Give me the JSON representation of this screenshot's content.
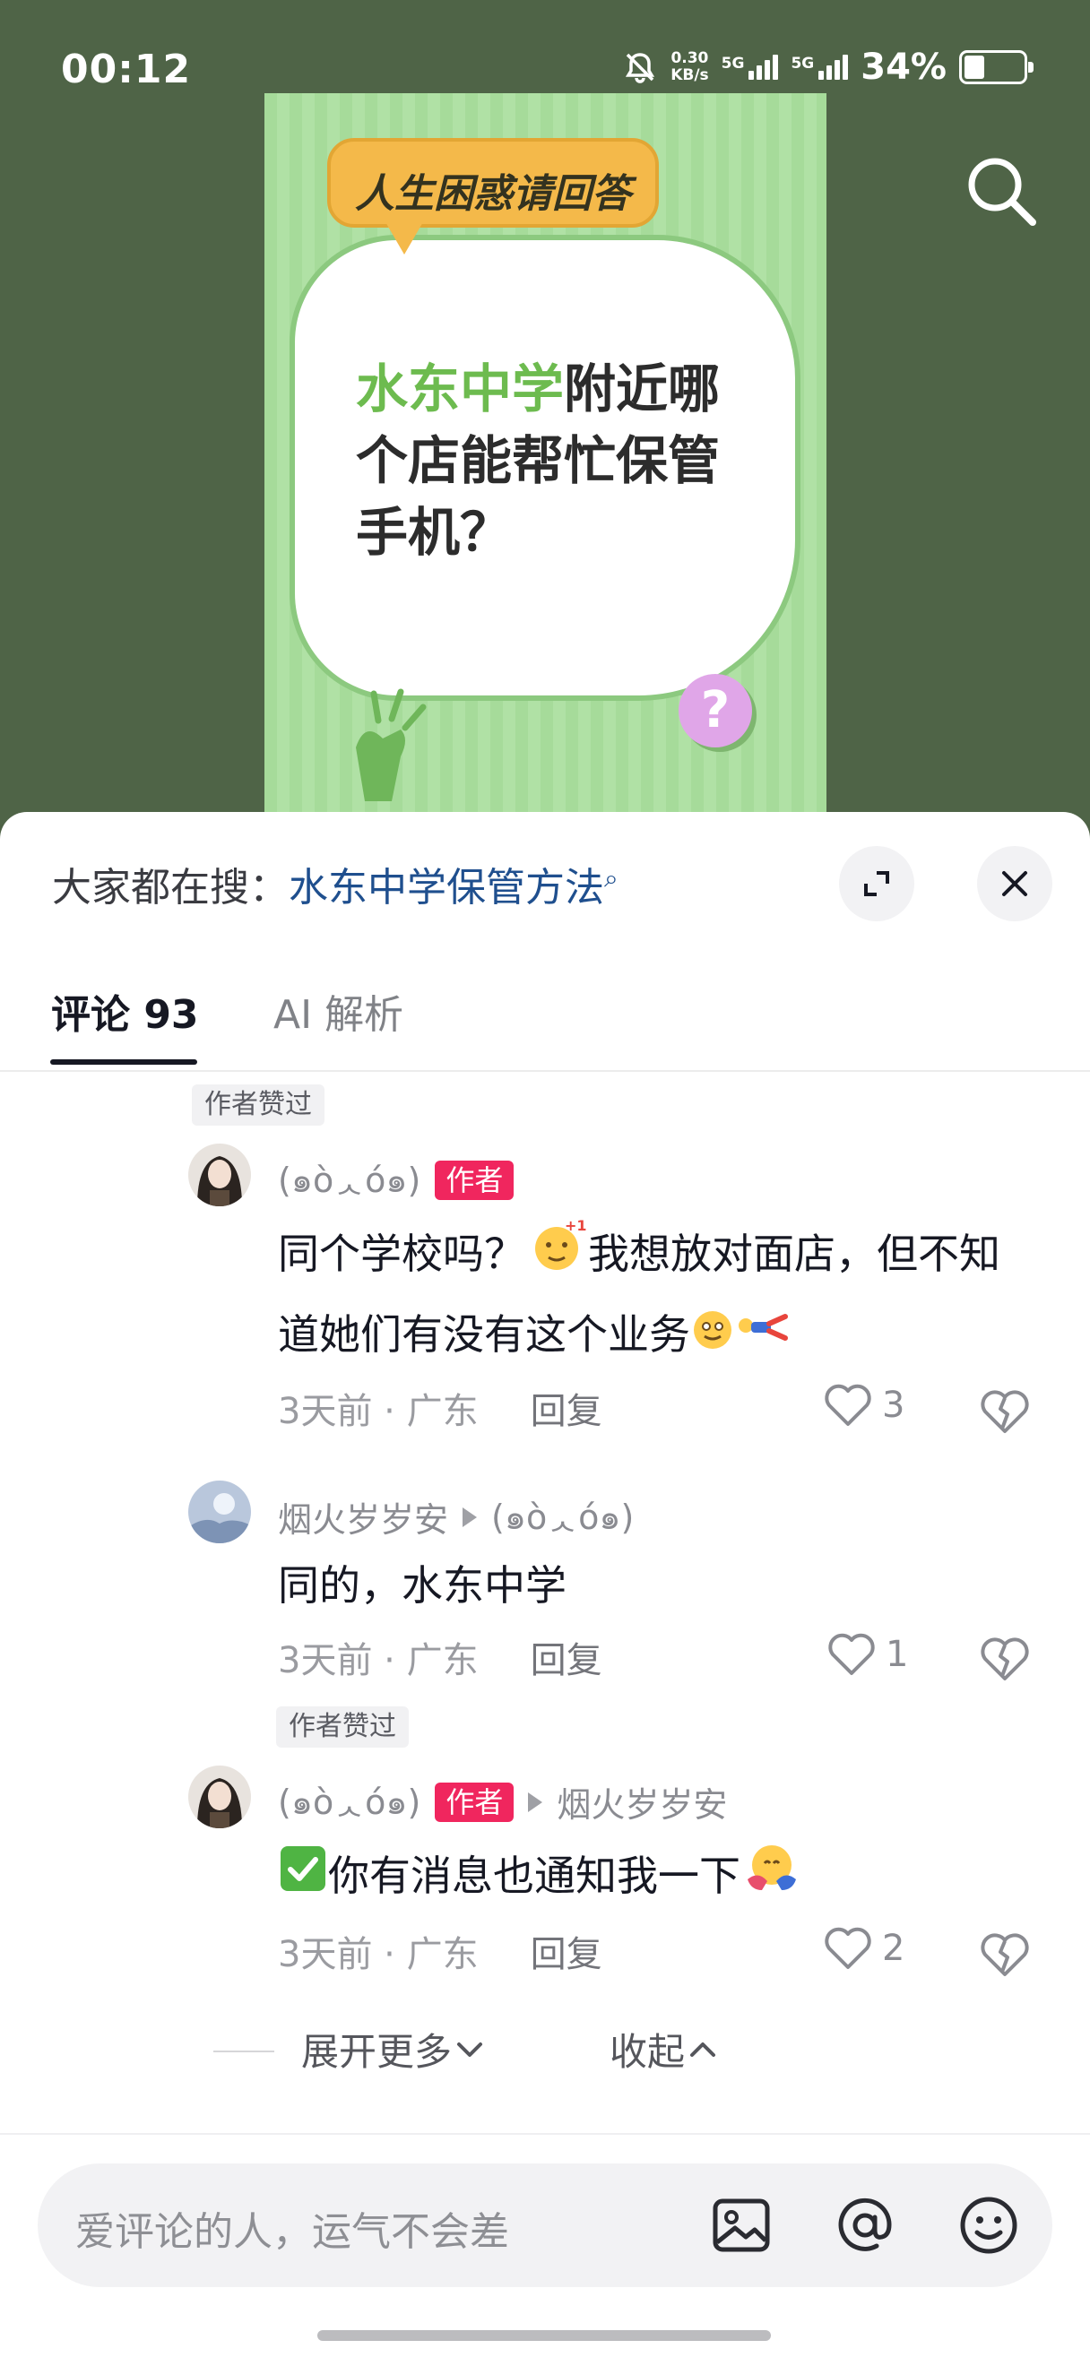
{
  "status_bar": {
    "time": "00:12",
    "net_speed_value": "0.30",
    "net_speed_unit": "KB/s",
    "network1": "5G",
    "network2": "5G",
    "battery": "34%"
  },
  "poster": {
    "header": "人生困惑请回答",
    "question_highlight": "水东中学",
    "question_rest": "附近哪个店能帮忙保管手机？",
    "badge": "?"
  },
  "panel": {
    "hot_search_prefix": "大家都在搜：",
    "hot_search_term": "水东中学保管方法",
    "tabs": [
      {
        "label": "评论 93"
      },
      {
        "label": "AI 解析"
      }
    ]
  },
  "comments": [
    {
      "badge": "作者赞过",
      "author": "(๑òᆺó๑)",
      "author_tag": "作者",
      "text_part1": "同个学校吗？",
      "text_part2": "我想放对面店，但不知道她们有没有这个业务",
      "time": "3天前 · 广东",
      "reply": "回复",
      "likes": "3"
    },
    {
      "author": "烟火岁岁安",
      "reply_to": "(๑òᆺó๑)",
      "text": "同的，水东中学",
      "time": "3天前 · 广东",
      "reply": "回复",
      "likes": "1"
    },
    {
      "badge": "作者赞过",
      "author": "(๑òᆺó๑)",
      "author_tag": "作者",
      "reply_to": "烟火岁岁安",
      "text": "你有消息也通知我一下",
      "time": "3天前 · 广东",
      "reply": "回复",
      "likes": "2"
    }
  ],
  "thread_actions": {
    "expand": "展开更多",
    "collapse": "收起"
  },
  "input": {
    "placeholder": "爱评论的人，运气不会差"
  },
  "icons": [
    "search-icon",
    "expand-icon",
    "close-icon",
    "heart-icon",
    "dislike-heart-icon",
    "image-icon",
    "at-icon",
    "emoji-icon"
  ]
}
